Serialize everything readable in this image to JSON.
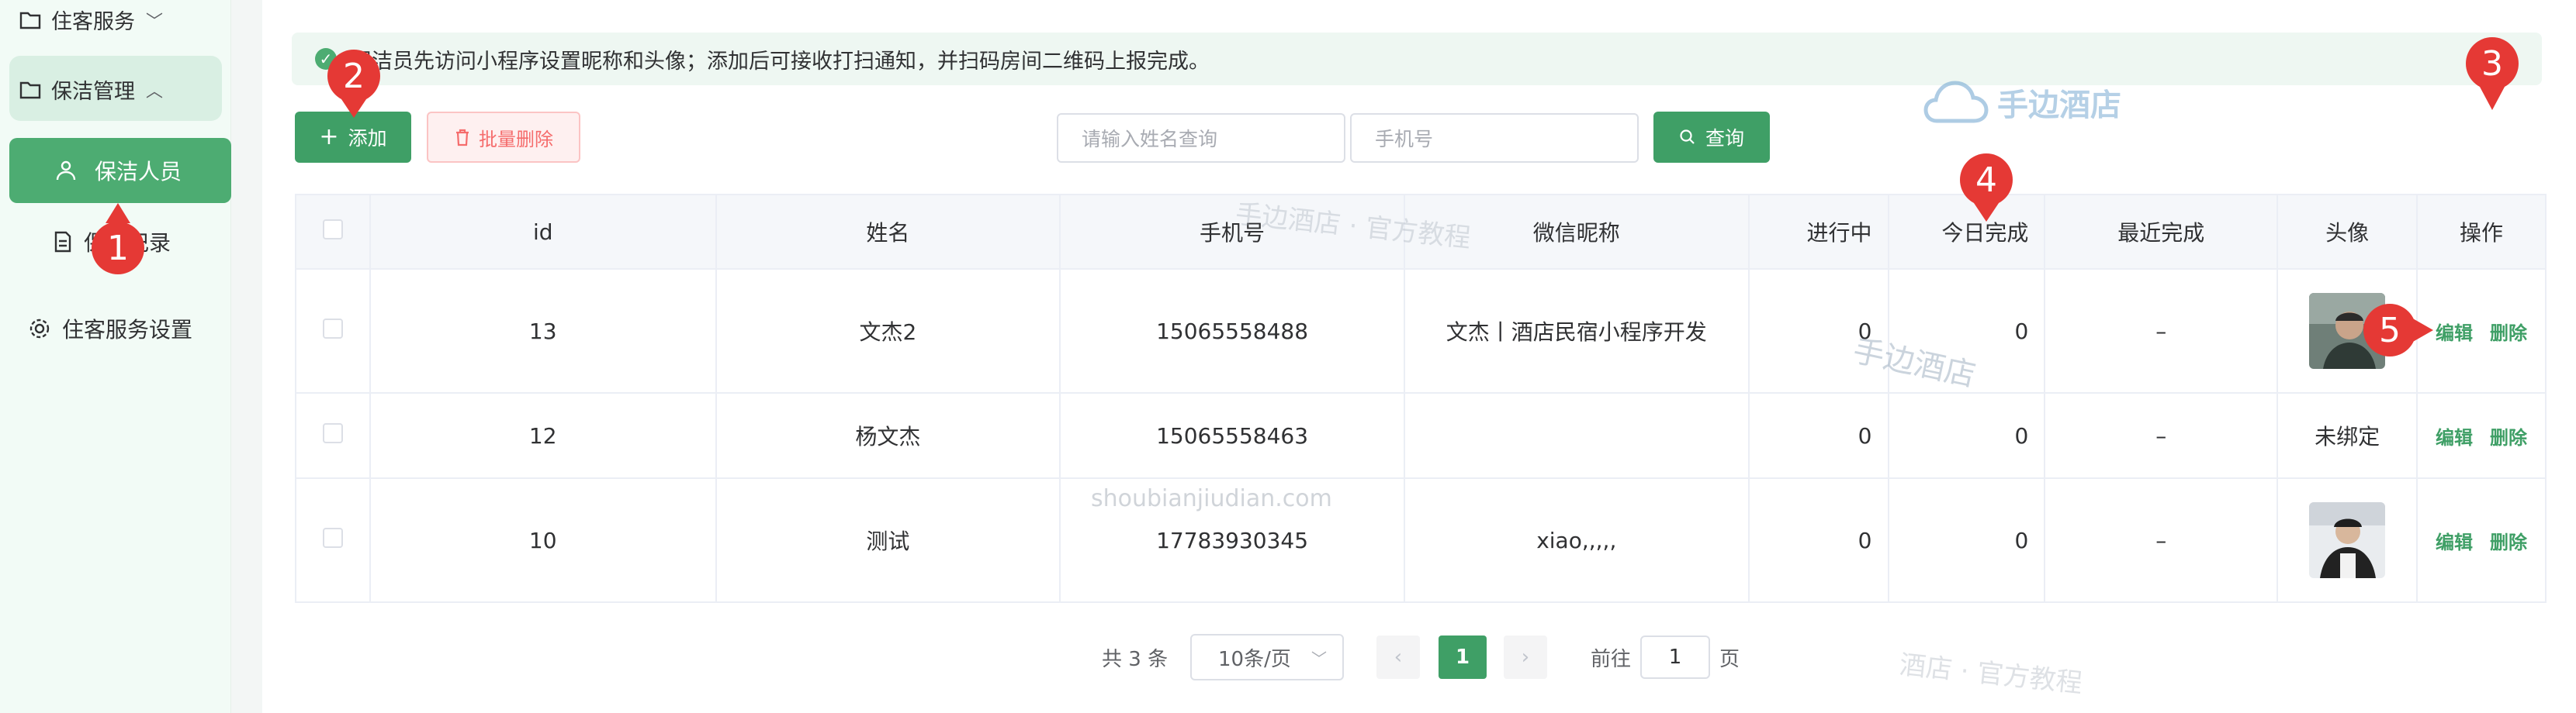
{
  "sidebar": {
    "items": [
      {
        "label": "住客服务",
        "icon": "folder-icon"
      },
      {
        "label": "保洁管理",
        "icon": "folder-icon"
      }
    ],
    "sub_active_label": "保洁人员",
    "sub_item_label": "保洁记录",
    "settings_label": "住客服务设置"
  },
  "tip": {
    "text": "保洁员先访问小程序设置昵称和头像；添加后可接收打扫通知，并扫码房间二维码上报完成。"
  },
  "toolbar": {
    "add_label": "添加",
    "batch_delete_label": "批量删除",
    "name_placeholder": "请输入姓名查询",
    "phone_placeholder": "手机号",
    "query_label": "查询"
  },
  "table": {
    "headers": [
      "id",
      "姓名",
      "手机号",
      "微信昵称",
      "进行中",
      "今日完成",
      "最近完成",
      "头像",
      "操作"
    ],
    "rows": [
      {
        "id": "13",
        "name": "文杰2",
        "phone": "15065558488",
        "wechat": "文杰丨酒店民宿小程序开发",
        "in_progress": "0",
        "today_done": "0",
        "last_done": "–",
        "avatar": "",
        "edit": "编辑",
        "delete": "删除"
      },
      {
        "id": "12",
        "name": "杨文杰",
        "phone": "15065558463",
        "wechat": "",
        "in_progress": "0",
        "today_done": "0",
        "last_done": "–",
        "avatar": "未绑定",
        "edit": "编辑",
        "delete": "删除"
      },
      {
        "id": "10",
        "name": "测试",
        "phone": "17783930345",
        "wechat": "xiao,,,,,",
        "in_progress": "0",
        "today_done": "0",
        "last_done": "–",
        "avatar": "",
        "edit": "编辑",
        "delete": "删除"
      }
    ]
  },
  "pagination": {
    "total": "共 3 条",
    "page_size": "10条/页",
    "current": "1",
    "goto_label": "前往",
    "goto_value": "1",
    "page_suffix": "页"
  },
  "watermarks": {
    "logo_text": "手边酒店",
    "tag1": "手边酒店 · 官方教程",
    "tag2": "手边酒店",
    "url": "shoubianjiudian.com",
    "tag3": "酒店 · 官方教程"
  },
  "annotations": [
    "1",
    "2",
    "3",
    "4",
    "5"
  ],
  "colors": {
    "primary": "#3f9f66",
    "danger": "#f56c6c",
    "badge": "#e53935"
  }
}
